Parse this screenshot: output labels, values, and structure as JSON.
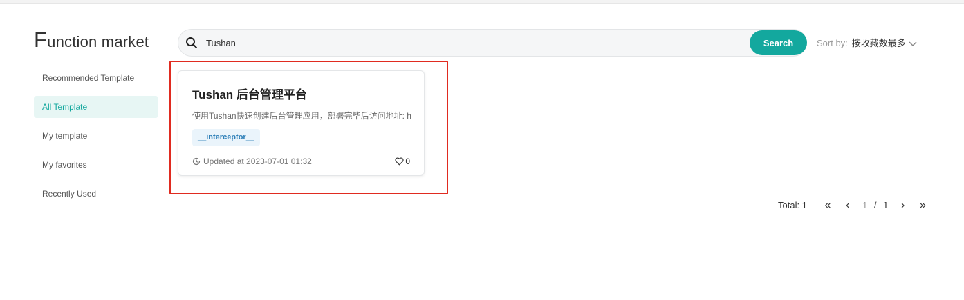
{
  "page": {
    "title_first": "F",
    "title_rest": "unction market"
  },
  "sidebar": {
    "items": [
      {
        "label": "Recommended Template"
      },
      {
        "label": "All Template"
      },
      {
        "label": "My template"
      },
      {
        "label": "My favorites"
      },
      {
        "label": "Recently Used"
      }
    ]
  },
  "search": {
    "value": "Tushan",
    "button_label": "Search"
  },
  "sort": {
    "label": "Sort by:",
    "value": "按收藏数最多"
  },
  "card": {
    "title": "Tushan 后台管理平台",
    "description": "使用Tushan快速创建后台管理应用，部署完毕后访问地址: h",
    "tag": "__interceptor__",
    "updated": "Updated at 2023-07-01 01:32",
    "likes": "0"
  },
  "pagination": {
    "total": "Total: 1",
    "first": "«",
    "prev": "‹",
    "current": "1",
    "separator": "/",
    "pages": "1",
    "next": "›",
    "last": "»"
  },
  "colors": {
    "accent": "#13a89e",
    "highlight_border": "#e02b20",
    "tag_text": "#2d7fb8"
  },
  "icons": {
    "search": "search-icon",
    "chevron": "chevron-down-icon",
    "clock": "clock-icon",
    "heart": "heart-icon"
  }
}
